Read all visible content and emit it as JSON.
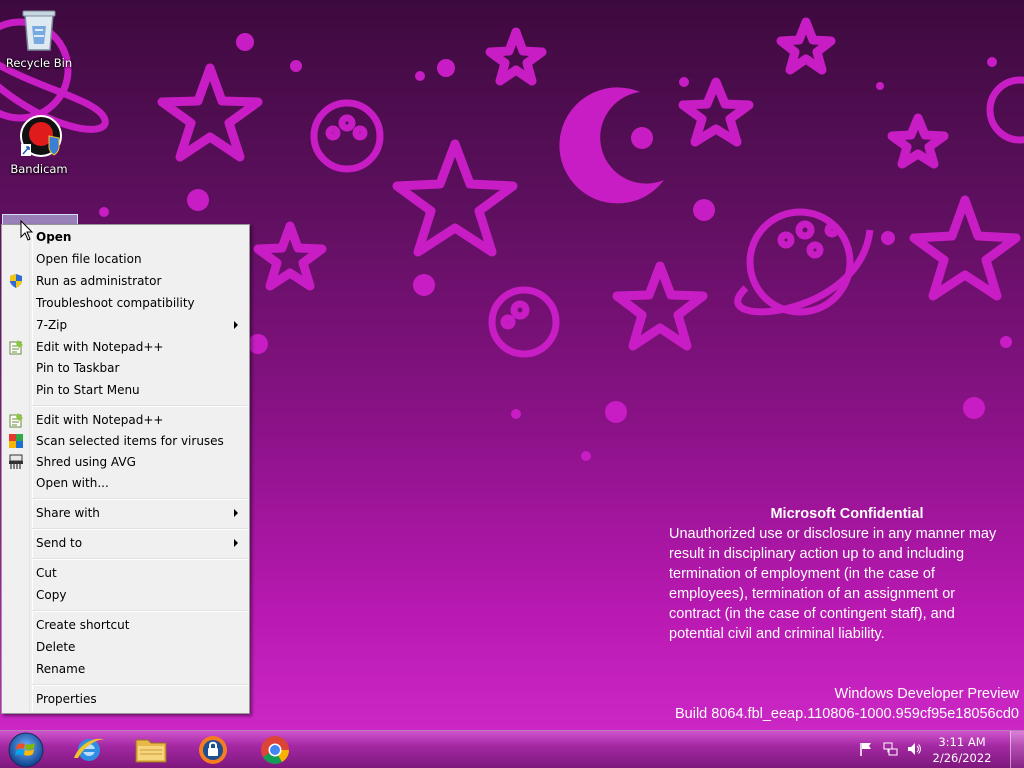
{
  "desktop": {
    "icons": [
      {
        "label": "Recycle Bin",
        "icon": "recycle-bin-icon"
      },
      {
        "label": "Bandicam",
        "icon": "bandicam-icon"
      }
    ]
  },
  "context_menu": {
    "items": [
      {
        "label": "Open"
      },
      {
        "label": "Open file location"
      },
      {
        "label": "Run as administrator",
        "icon": "uac-shield-icon"
      },
      {
        "label": "Troubleshoot compatibility"
      },
      {
        "label": "7-Zip"
      },
      {
        "label": "Edit with Notepad++",
        "icon": "notepad-plus-plus-icon"
      },
      {
        "label": "Pin to Taskbar"
      },
      {
        "label": "Pin to Start Menu"
      },
      {
        "label": "Edit with Notepad++",
        "icon": "notepad-plus-plus-icon"
      },
      {
        "label": "Scan selected items for viruses",
        "icon": "avg-scan-icon"
      },
      {
        "label": "Shred using AVG",
        "icon": "shredder-icon"
      },
      {
        "label": "Open with..."
      },
      {
        "label": "Share with"
      },
      {
        "label": "Send to"
      },
      {
        "label": "Cut"
      },
      {
        "label": "Copy"
      },
      {
        "label": "Create shortcut"
      },
      {
        "label": "Delete"
      },
      {
        "label": "Rename"
      },
      {
        "label": "Properties"
      }
    ]
  },
  "overlay": {
    "confidential_title": "Microsoft Confidential",
    "confidential_lines": [
      "Unauthorized use or disclosure in any manner may",
      "result in disciplinary action up to and including",
      "termination of employment (in the case of",
      "employees), termination of an assignment or",
      "contract (in the case of contingent staff), and",
      "potential civil and criminal liability."
    ],
    "watermark_line1": "Windows Developer Preview",
    "watermark_line2": "Build 8064.fbl_eeap.110806-1000.959cf95e18056cd0"
  },
  "taskbar": {
    "pinned": [
      {
        "icon": "internet-explorer-icon"
      },
      {
        "icon": "file-explorer-icon"
      },
      {
        "icon": "avast-secure-browser-icon"
      },
      {
        "icon": "chrome-icon"
      }
    ],
    "tray_icons": [
      "action-center-flag-icon",
      "network-icon",
      "volume-icon"
    ],
    "clock_time": "3:11 AM",
    "clock_date": "2/26/2022"
  },
  "colors": {
    "wallpaper_dark": "#3d0a3e",
    "wallpaper_light": "#d22ccc",
    "decoration": "#c81dc4",
    "menu_background": "#f0f0f0"
  }
}
